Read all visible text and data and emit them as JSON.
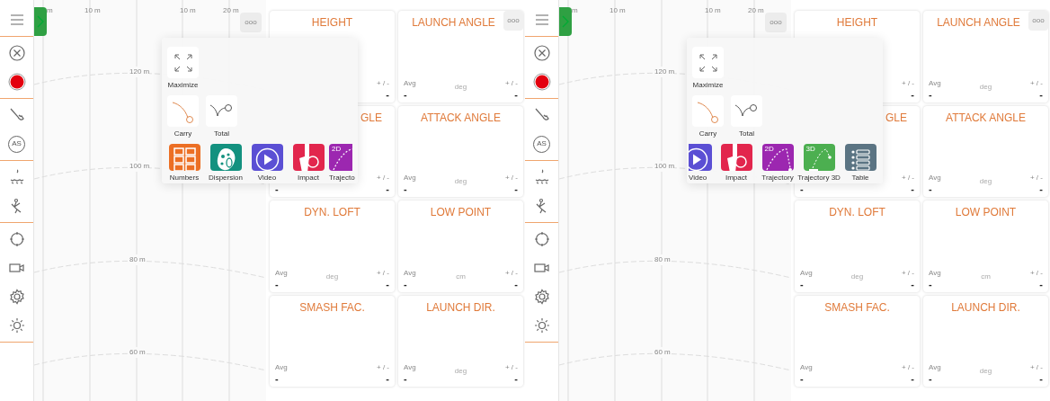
{
  "panels": [
    {
      "as_label": "AS",
      "chart_more": "ooo",
      "chart": {
        "top_labels": [
          "m",
          "10 m",
          "10 m",
          "20 m"
        ],
        "range_labels": [
          "120 m",
          "100 m",
          "80 m",
          "60 m"
        ]
      },
      "popup": {
        "maximize": {
          "label": "Maximize"
        },
        "views": [
          {
            "kind": "carry",
            "label": "Carry"
          },
          {
            "kind": "total",
            "label": "Total"
          }
        ],
        "widgets": [
          {
            "kind": "numbers",
            "label": "Numbers",
            "partial": false
          },
          {
            "kind": "dispersion",
            "label": "Dispersion",
            "partial": false
          },
          {
            "kind": "video",
            "label": "Video",
            "partial": false
          },
          {
            "kind": "impact",
            "label": "Impact",
            "partial": false
          },
          {
            "kind": "trajectory",
            "label": "Trajecto",
            "badge": "2D",
            "partial": true
          }
        ]
      },
      "cards": [
        {
          "title": "HEIGHT",
          "obscured": false,
          "spread_label": "+ / -",
          "spread": "-"
        },
        {
          "title": "LAUNCH ANGLE",
          "obscured": false,
          "more": "ooo",
          "avg_label": "Avg",
          "avg": "-",
          "unit": "deg",
          "spread_label": "+ / -",
          "spread": "-"
        },
        {
          "title": "GLE",
          "obscured": true,
          "avg": "-",
          "spread_label": "+ / -",
          "spread": "-"
        },
        {
          "title": "ATTACK ANGLE",
          "obscured": false,
          "avg_label": "Avg",
          "avg": "-",
          "unit": "deg",
          "spread_label": "+ / -",
          "spread": "-"
        },
        {
          "title": "DYN. LOFT",
          "obscured": false,
          "avg_label": "Avg",
          "avg": "-",
          "unit": "deg",
          "spread_label": "+ / -",
          "spread": "-"
        },
        {
          "title": "LOW POINT",
          "obscured": false,
          "avg_label": "Avg",
          "avg": "-",
          "unit": "cm",
          "spread_label": "+ / -",
          "spread": "-"
        },
        {
          "title": "SMASH FAC.",
          "obscured": false,
          "avg_label": "Avg",
          "avg": "-",
          "spread_label": "+ / -",
          "spread": "-"
        },
        {
          "title": "LAUNCH DIR.",
          "obscured": false,
          "avg_label": "Avg",
          "avg": "-",
          "unit": "deg",
          "spread_label": "+ / -",
          "spread": "-"
        }
      ]
    },
    {
      "as_label": "AS",
      "chart_more": "ooo",
      "chart": {
        "top_labels": [
          "m",
          "10 m",
          "10 m",
          "20 m"
        ],
        "range_labels": [
          "120 m",
          "100 m",
          "80 m",
          "60 m"
        ]
      },
      "popup": {
        "maximize": {
          "label": "Maximize"
        },
        "views": [
          {
            "kind": "carry",
            "label": "Carry"
          },
          {
            "kind": "total",
            "label": "Total"
          }
        ],
        "widgets": [
          {
            "kind": "video",
            "label": "Video",
            "partial": true
          },
          {
            "kind": "impact",
            "label": "Impact",
            "partial": false
          },
          {
            "kind": "trajectory",
            "label": "Trajectory",
            "badge": "2D",
            "partial": false
          },
          {
            "kind": "trajectory3d",
            "label": "Trajectory 3D",
            "badge": "3D",
            "partial": false
          },
          {
            "kind": "table",
            "label": "Table",
            "partial": false
          }
        ]
      },
      "cards": [
        {
          "title": "HEIGHT",
          "obscured": false,
          "spread_label": "+ / -",
          "spread": "-"
        },
        {
          "title": "LAUNCH ANGLE",
          "obscured": false,
          "more": "ooo",
          "avg_label": "Avg",
          "avg": "-",
          "unit": "deg",
          "spread_label": "+ / -",
          "spread": "-"
        },
        {
          "title": "GLE",
          "obscured": true,
          "avg": "-",
          "spread_label": "+ / -",
          "spread": "-"
        },
        {
          "title": "ATTACK ANGLE",
          "obscured": false,
          "avg_label": "Avg",
          "avg": "-",
          "unit": "deg",
          "spread_label": "+ / -",
          "spread": "-"
        },
        {
          "title": "DYN. LOFT",
          "obscured": false,
          "avg_label": "Avg",
          "avg": "-",
          "unit": "deg",
          "spread_label": "+ / -",
          "spread": "-"
        },
        {
          "title": "LOW POINT",
          "obscured": false,
          "avg_label": "Avg",
          "avg": "-",
          "unit": "cm",
          "spread_label": "+ / -",
          "spread": "-"
        },
        {
          "title": "SMASH FAC.",
          "obscured": false,
          "avg_label": "Avg",
          "avg": "-",
          "spread_label": "+ / -",
          "spread": "-"
        },
        {
          "title": "LAUNCH DIR.",
          "obscured": false,
          "avg_label": "Avg",
          "avg": "-",
          "unit": "deg",
          "spread_label": "+ / -",
          "spread": "-"
        }
      ]
    }
  ]
}
